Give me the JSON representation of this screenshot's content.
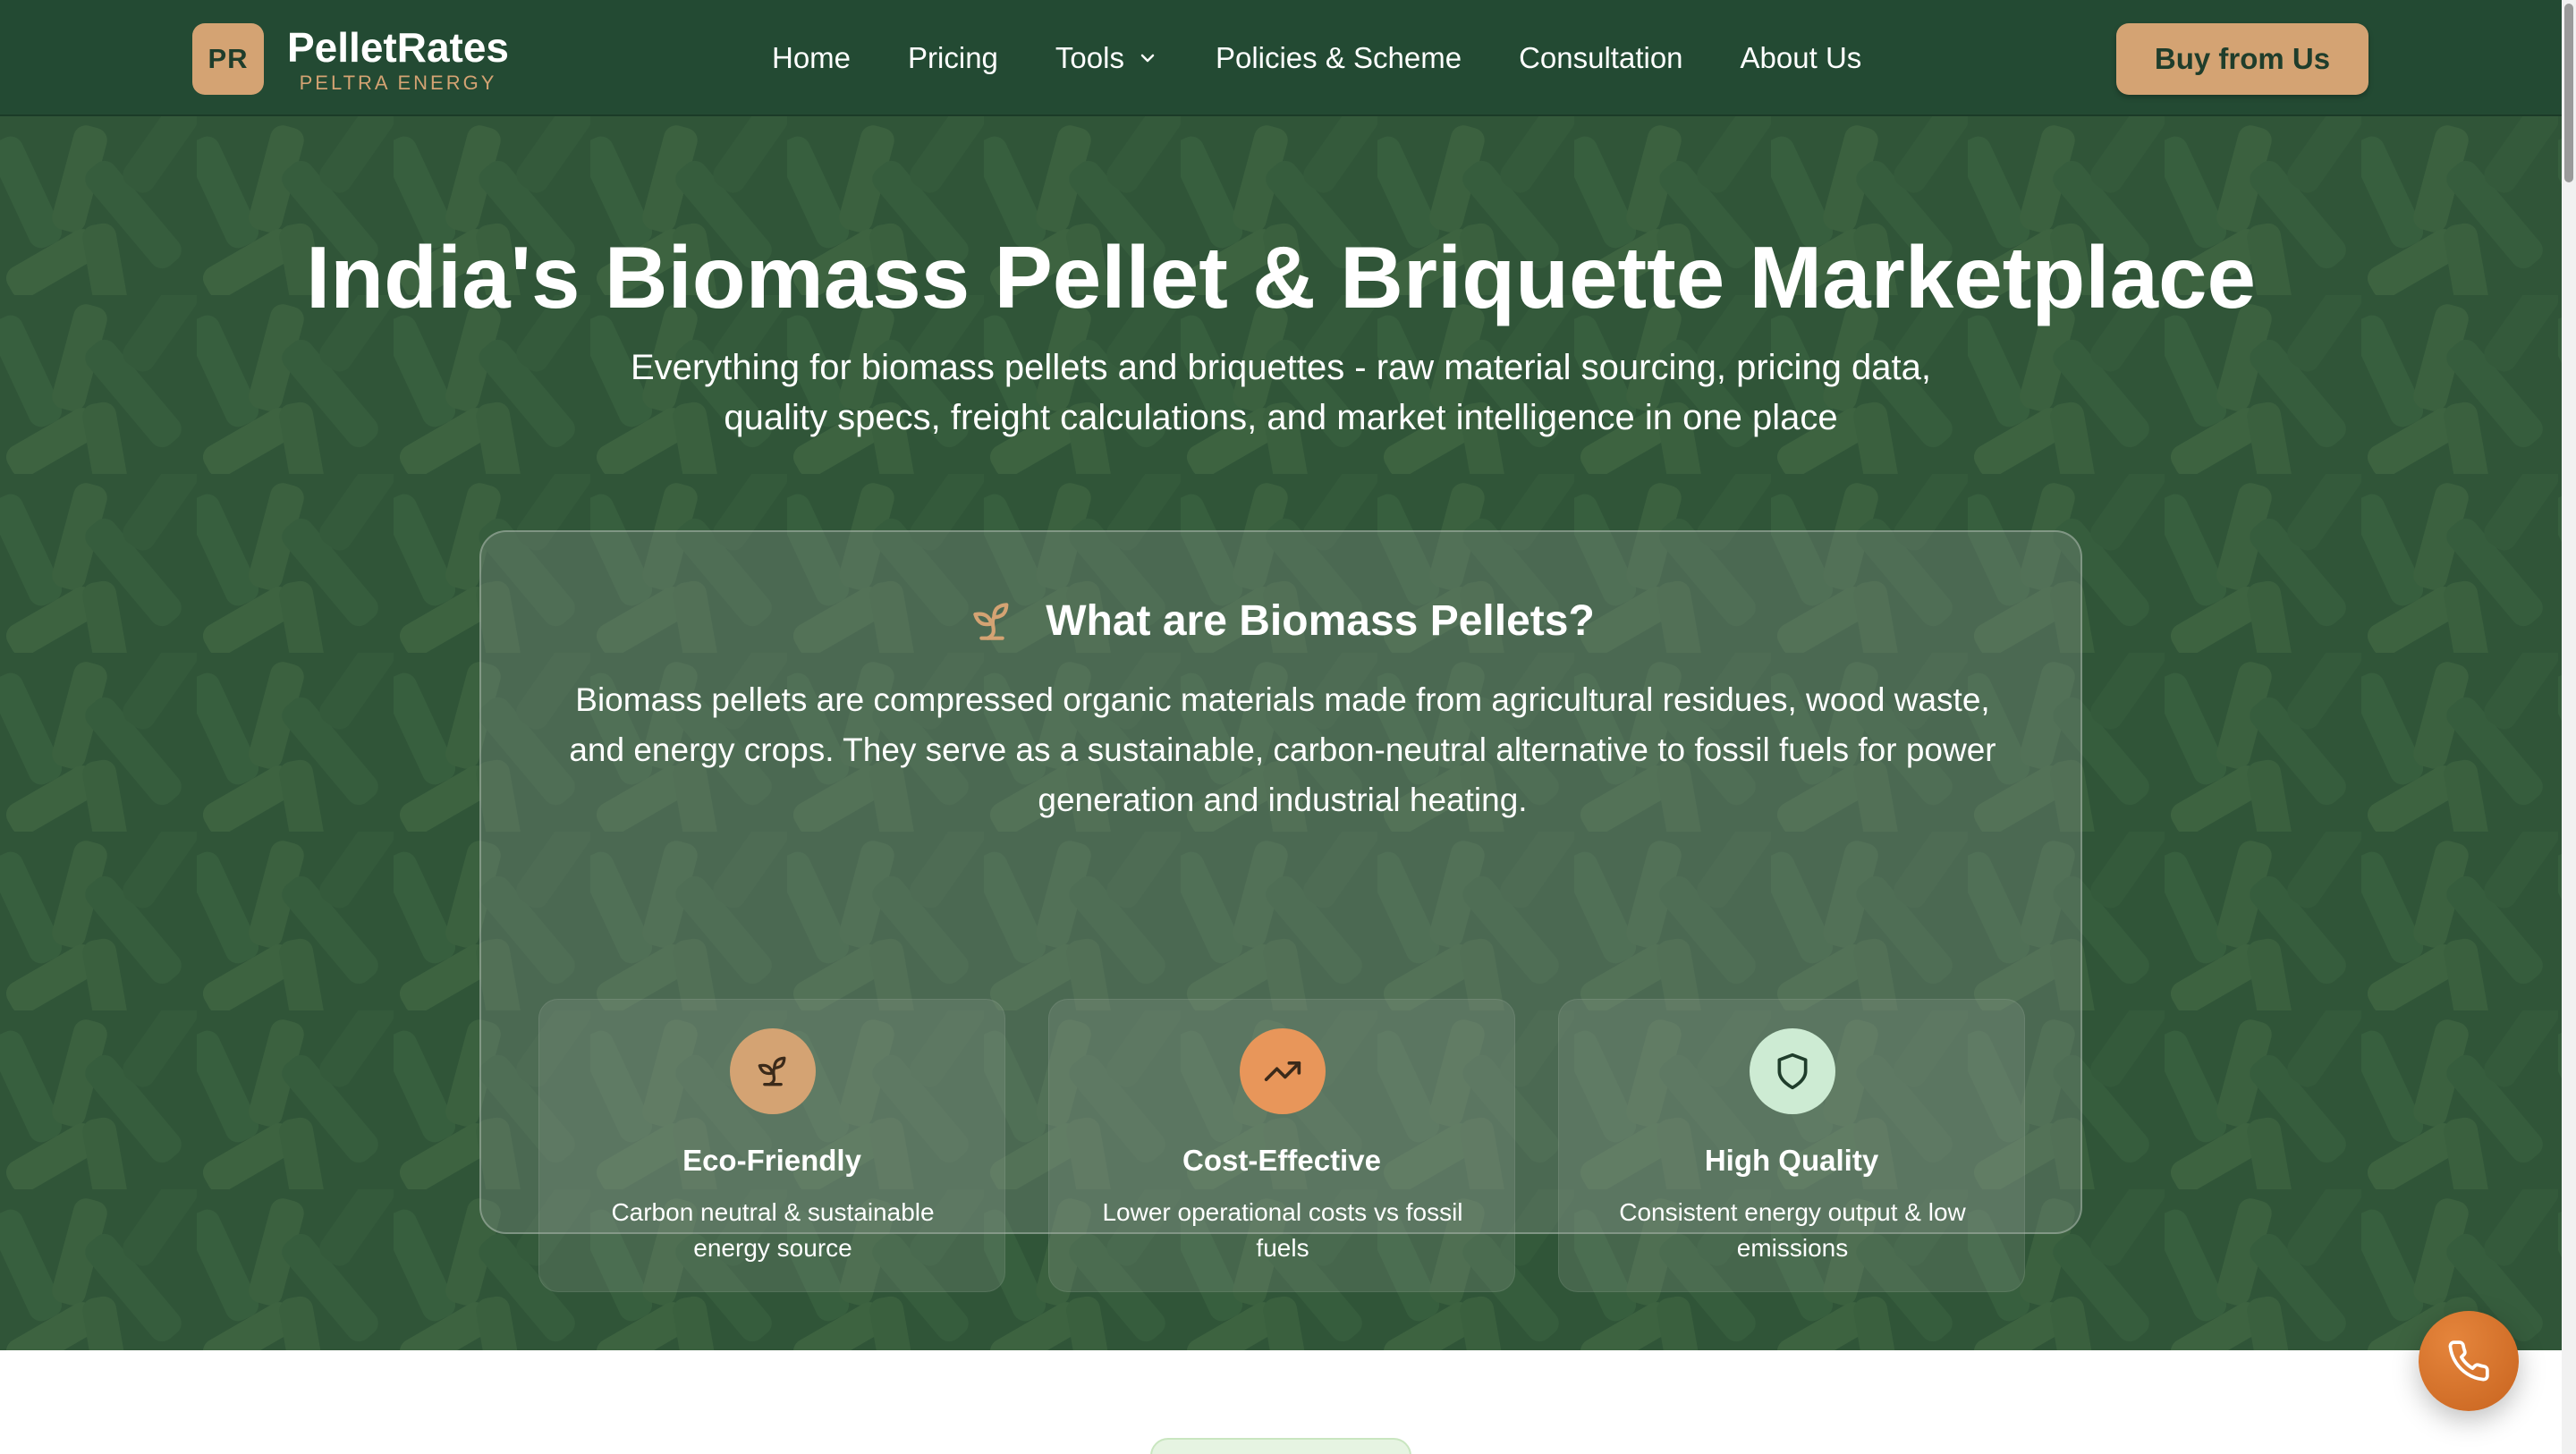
{
  "brand": {
    "initials": "PR",
    "name": "PelletRates",
    "tagline": "PELTRA ENERGY"
  },
  "nav": {
    "items": [
      {
        "label": "Home"
      },
      {
        "label": "Pricing"
      },
      {
        "label": "Tools",
        "has_dropdown": true
      },
      {
        "label": "Policies & Scheme"
      },
      {
        "label": "Consultation"
      },
      {
        "label": "About Us"
      }
    ],
    "cta_label": "Buy from Us"
  },
  "hero": {
    "title": "India's Biomass Pellet & Briquette Marketplace",
    "subtitle": "Everything for biomass pellets and briquettes - raw material sourcing, pricing data, quality specs, freight calculations, and market intelligence in one place"
  },
  "info_card": {
    "icon": "sprout-icon",
    "title": "What are Biomass Pellets?",
    "description": "Biomass pellets are compressed organic materials made from agricultural residues, wood waste, and energy crops. They serve as a sustainable, carbon-neutral alternative to fossil fuels for power generation and industrial heating.",
    "features": [
      {
        "icon": "sprout-icon",
        "title": "Eco-Friendly",
        "description": "Carbon neutral & sustainable energy source",
        "color": "#d4a373"
      },
      {
        "icon": "trending-up-icon",
        "title": "Cost-Effective",
        "description": "Lower operational costs vs fossil fuels",
        "color": "#e8965a"
      },
      {
        "icon": "shield-icon",
        "title": "High Quality",
        "description": "Consistent energy output & low emissions",
        "color": "#cdebd3"
      }
    ]
  },
  "colors": {
    "nav_bg": "#234a33",
    "accent": "#d4a373",
    "call_button": "#d9732e"
  },
  "floating_action": {
    "icon": "phone-icon"
  }
}
